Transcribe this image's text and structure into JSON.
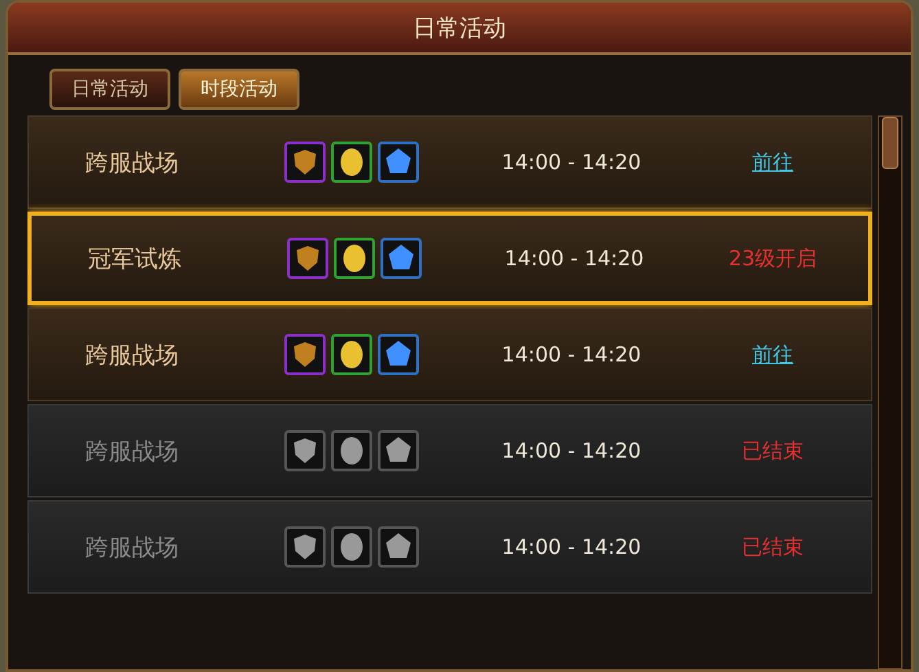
{
  "window": {
    "title": "日常活动"
  },
  "tabs": [
    {
      "label": "日常活动",
      "selected": false
    },
    {
      "label": "时段活动",
      "selected": true
    }
  ],
  "activities": [
    {
      "name": "跨服战场",
      "selected": false,
      "ended": false,
      "time": "14:00 - 14:20",
      "action": {
        "kind": "link",
        "text": "前往"
      }
    },
    {
      "name": "冠军试炼",
      "selected": true,
      "ended": false,
      "time": "14:00 - 14:20",
      "action": {
        "kind": "locked",
        "text": "23级开启"
      }
    },
    {
      "name": "跨服战场",
      "selected": false,
      "ended": false,
      "time": "14:00 - 14:20",
      "action": {
        "kind": "link",
        "text": "前往"
      }
    },
    {
      "name": "跨服战场",
      "selected": false,
      "ended": true,
      "time": "14:00 - 14:20",
      "action": {
        "kind": "ended",
        "text": "已结束"
      }
    },
    {
      "name": "跨服战场",
      "selected": false,
      "ended": true,
      "time": "14:00 - 14:20",
      "action": {
        "kind": "ended",
        "text": "已结束"
      }
    }
  ]
}
